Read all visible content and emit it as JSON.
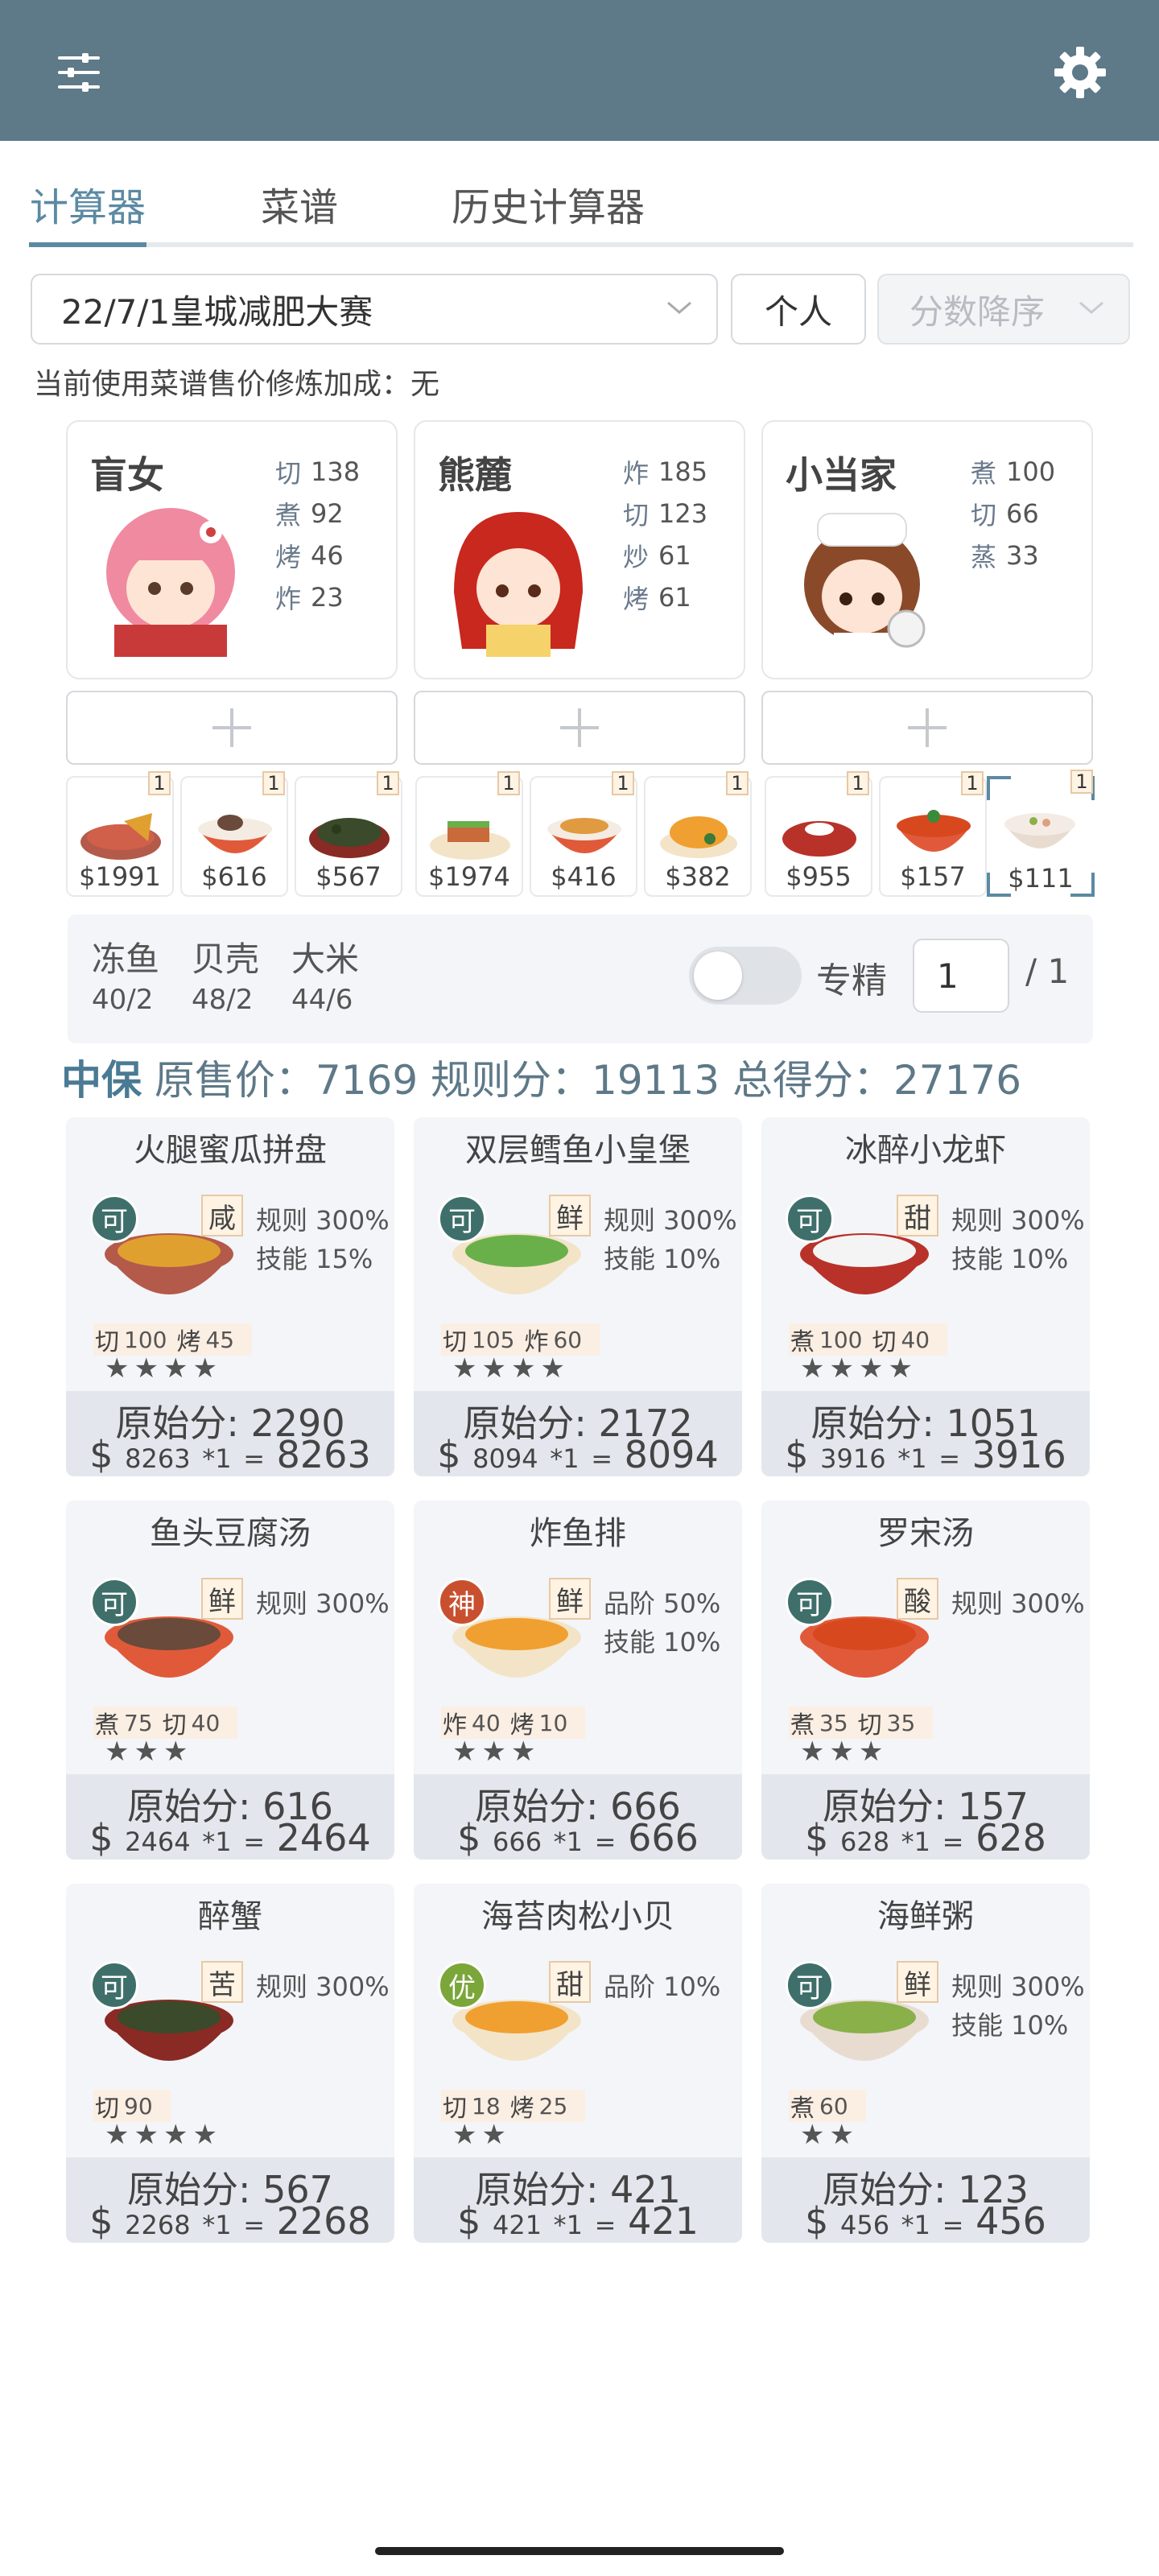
{
  "toolbar": {
    "left_icon": "sliders-icon",
    "right_icon": "gear-icon"
  },
  "tabs": [
    {
      "label": "计算器",
      "active": true
    },
    {
      "label": "菜谱",
      "active": false
    },
    {
      "label": "历史计算器",
      "active": false
    }
  ],
  "filters": {
    "rule_select": "22/7/1皇城减肥大赛",
    "mode_select": "个人",
    "sort_select": "分数降序"
  },
  "bonus_text": "当前使用菜谱售价修炼加成：无",
  "chefs": [
    {
      "name": "盲女",
      "skills": [
        {
          "k": "切",
          "v": "138"
        },
        {
          "k": "煮",
          "v": "92"
        },
        {
          "k": "烤",
          "v": "46"
        },
        {
          "k": "炸",
          "v": "23"
        }
      ]
    },
    {
      "name": "熊麓",
      "skills": [
        {
          "k": "炸",
          "v": "185"
        },
        {
          "k": "切",
          "v": "123"
        },
        {
          "k": "炒",
          "v": "61"
        },
        {
          "k": "烤",
          "v": "61"
        }
      ]
    },
    {
      "name": "小当家",
      "skills": [
        {
          "k": "煮",
          "v": "100"
        },
        {
          "k": "切",
          "v": "66"
        },
        {
          "k": "蒸",
          "v": "33"
        }
      ]
    }
  ],
  "dish_slots": [
    {
      "price": "$1991",
      "count": "1"
    },
    {
      "price": "$616",
      "count": "1"
    },
    {
      "price": "$567",
      "count": "1"
    },
    {
      "price": "$1974",
      "count": "1"
    },
    {
      "price": "$416",
      "count": "1"
    },
    {
      "price": "$382",
      "count": "1"
    },
    {
      "price": "$955",
      "count": "1"
    },
    {
      "price": "$157",
      "count": "1"
    },
    {
      "price": "$111",
      "count": "1"
    }
  ],
  "materials": [
    {
      "name": "冻鱼",
      "ratio": "40/2"
    },
    {
      "name": "贝壳",
      "ratio": "48/2"
    },
    {
      "name": "大米",
      "ratio": "44/6"
    }
  ],
  "specialize": {
    "label": "专精",
    "value": "1",
    "total": "/ 1",
    "enabled": false
  },
  "summary": {
    "grade": "中保",
    "text": "原售价：7169 规则分：19113 总得分：27176"
  },
  "results": [
    {
      "title": "火腿蜜瓜拼盘",
      "grade": "可",
      "grade_color": "#3f6f6a",
      "taste": "咸",
      "rules": [
        "规则 300%",
        "技能 15%"
      ],
      "skills": [
        {
          "k": "切",
          "v": "100"
        },
        {
          "k": "烤",
          "v": "45"
        }
      ],
      "stars": "★★★★",
      "raw": "原始分: 2290",
      "price": "8263",
      "mult": "*1",
      "total": "8263"
    },
    {
      "title": "双层鳕鱼小皇堡",
      "grade": "可",
      "grade_color": "#3f6f6a",
      "taste": "鲜",
      "rules": [
        "规则 300%",
        "技能 10%"
      ],
      "skills": [
        {
          "k": "切",
          "v": "105"
        },
        {
          "k": "炸",
          "v": "60"
        }
      ],
      "stars": "★★★★",
      "raw": "原始分: 2172",
      "price": "8094",
      "mult": "*1",
      "total": "8094"
    },
    {
      "title": "冰醉小龙虾",
      "grade": "可",
      "grade_color": "#3f6f6a",
      "taste": "甜",
      "rules": [
        "规则 300%",
        "技能 10%"
      ],
      "skills": [
        {
          "k": "煮",
          "v": "100"
        },
        {
          "k": "切",
          "v": "40"
        }
      ],
      "stars": "★★★★",
      "raw": "原始分: 1051",
      "price": "3916",
      "mult": "*1",
      "total": "3916"
    },
    {
      "title": "鱼头豆腐汤",
      "grade": "可",
      "grade_color": "#3f6f6a",
      "taste": "鲜",
      "rules": [
        "规则 300%"
      ],
      "skills": [
        {
          "k": "煮",
          "v": "75"
        },
        {
          "k": "切",
          "v": "40"
        }
      ],
      "stars": "★★★",
      "raw": "原始分: 616",
      "price": "2464",
      "mult": "*1",
      "total": "2464"
    },
    {
      "title": "炸鱼排",
      "grade": "神",
      "grade_color": "#c9502f",
      "taste": "鲜",
      "rules": [
        "品阶 50%",
        "技能 10%"
      ],
      "skills": [
        {
          "k": "炸",
          "v": "40"
        },
        {
          "k": "烤",
          "v": "10"
        }
      ],
      "stars": "★★★",
      "raw": "原始分: 666",
      "price": "666",
      "mult": "*1",
      "total": "666"
    },
    {
      "title": "罗宋汤",
      "grade": "可",
      "grade_color": "#3f6f6a",
      "taste": "酸",
      "rules": [
        "规则 300%"
      ],
      "skills": [
        {
          "k": "煮",
          "v": "35"
        },
        {
          "k": "切",
          "v": "35"
        }
      ],
      "stars": "★★★",
      "raw": "原始分: 157",
      "price": "628",
      "mult": "*1",
      "total": "628"
    },
    {
      "title": "醉蟹",
      "grade": "可",
      "grade_color": "#3f6f6a",
      "taste": "苦",
      "rules": [
        "规则 300%"
      ],
      "skills": [
        {
          "k": "切",
          "v": "90"
        }
      ],
      "stars": "★★★★",
      "raw": "原始分: 567",
      "price": "2268",
      "mult": "*1",
      "total": "2268"
    },
    {
      "title": "海苔肉松小贝",
      "grade": "优",
      "grade_color": "#7aa63a",
      "taste": "甜",
      "rules": [
        "品阶 10%"
      ],
      "skills": [
        {
          "k": "切",
          "v": "18"
        },
        {
          "k": "烤",
          "v": "25"
        }
      ],
      "stars": "★★",
      "raw": "原始分: 421",
      "price": "421",
      "mult": "*1",
      "total": "421"
    },
    {
      "title": "海鲜粥",
      "grade": "可",
      "grade_color": "#3f6f6a",
      "taste": "鲜",
      "rules": [
        "规则 300%",
        "技能 10%"
      ],
      "skills": [
        {
          "k": "煮",
          "v": "60"
        }
      ],
      "stars": "★★",
      "raw": "原始分: 123",
      "price": "456",
      "mult": "*1",
      "total": "456"
    }
  ]
}
